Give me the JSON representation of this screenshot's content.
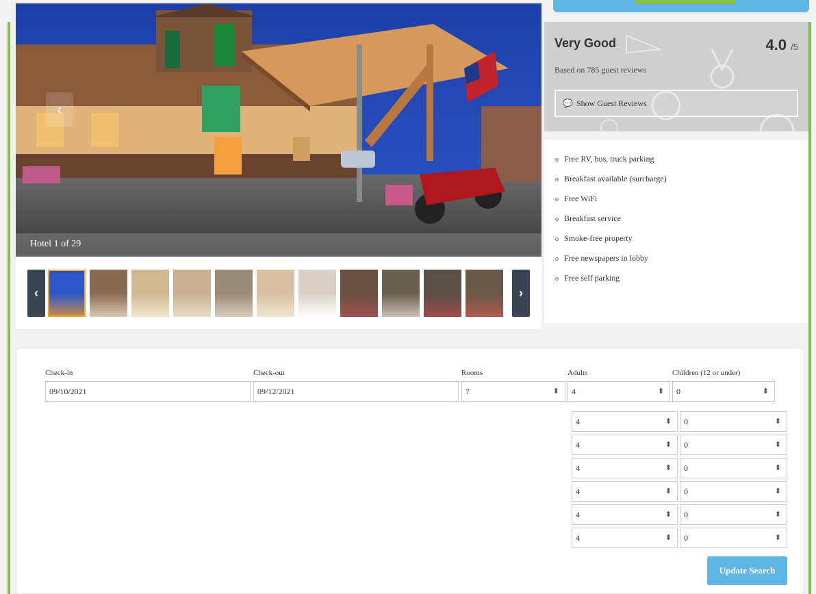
{
  "gallery": {
    "caption": "Hotel 1 of 29",
    "prev_label": "‹",
    "next_label": "›",
    "thumbnail_count": 11
  },
  "rating": {
    "label": "Very Good",
    "score": "4.0",
    "denominator": "/5",
    "review_count_text": "Based on 785 guest reviews",
    "show_reviews_label": "Show Guest Reviews"
  },
  "amenities": [
    "Free RV, bus, truck parking",
    "Breakfast available (surcharge)",
    "Free WiFi",
    "Breakfast service",
    "Smoke-free property",
    "Free newspapers in lobby",
    "Free self parking"
  ],
  "booking": {
    "checkin_label": "Check-in",
    "checkin_value": "09/10/2021",
    "checkout_label": "Check-out",
    "checkout_value": "09/12/2021",
    "rooms_label": "Rooms",
    "rooms_value": "7",
    "adults_label": "Adults",
    "children_label": "Children (12 or under)",
    "room_rows": [
      {
        "adults": "4",
        "children": "0"
      },
      {
        "adults": "4",
        "children": "0"
      },
      {
        "adults": "4",
        "children": "0"
      },
      {
        "adults": "4",
        "children": "0"
      },
      {
        "adults": "4",
        "children": "0"
      },
      {
        "adults": "4",
        "children": "0"
      },
      {
        "adults": "4",
        "children": "0"
      }
    ],
    "update_label": "Update Search"
  },
  "colors": {
    "accent_green": "#7ac143",
    "button_blue": "#5fb6e6",
    "thumb_nav": "#3a4552"
  }
}
